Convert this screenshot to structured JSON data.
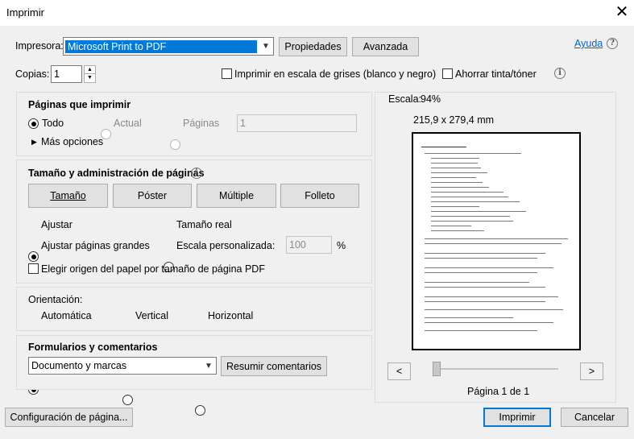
{
  "window": {
    "title": "Imprimir"
  },
  "printer": {
    "label": "Impresora:",
    "selected": "Microsoft Print to PDF",
    "properties_btn": "Propiedades",
    "advanced_btn": "Avanzada",
    "help_link": "Ayuda"
  },
  "copies": {
    "label": "Copias:",
    "value": "1",
    "grayscale_label": "Imprimir en escala de grises (blanco y negro)",
    "grayscale_checked": false,
    "save_ink_label": "Ahorrar tinta/tóner",
    "save_ink_checked": false
  },
  "pages": {
    "title": "Páginas que imprimir",
    "all": "Todo",
    "current": "Actual",
    "pages": "Páginas",
    "pages_value": "1",
    "more_options": "Más opciones",
    "selected": "all"
  },
  "sizing": {
    "title": "Tamaño y administración de páginas",
    "tab_size": "Tamaño",
    "tab_poster": "Póster",
    "tab_multiple": "Múltiple",
    "tab_booklet": "Folleto",
    "fit": "Ajustar",
    "actual_size": "Tamaño real",
    "shrink": "Ajustar páginas grandes",
    "custom_scale": "Escala personalizada:",
    "custom_scale_value": "100",
    "percent": "%",
    "choose_source": "Elegir origen del papel por tamaño de página PDF",
    "selected": "fit"
  },
  "orientation": {
    "title": "Orientación:",
    "auto": "Automática",
    "portrait": "Vertical",
    "landscape": "Horizontal",
    "selected": "auto"
  },
  "forms": {
    "title": "Formularios y comentarios",
    "selected": "Documento y marcas",
    "summarize_btn": "Resumir comentarios"
  },
  "preview": {
    "scale_label": "Escala:",
    "scale_value": "94%",
    "dimensions": "215,9 x 279,4 mm",
    "prev_btn": "<",
    "next_btn": ">",
    "page_indicator": "Página 1 de 1",
    "slider_fraction": 0
  },
  "footer": {
    "page_setup_btn": "Configuración de página...",
    "print_btn": "Imprimir",
    "cancel_btn": "Cancelar"
  }
}
